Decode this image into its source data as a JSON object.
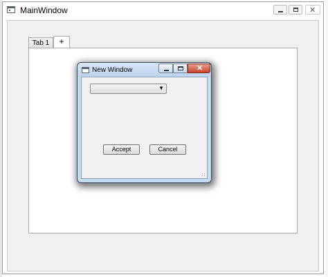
{
  "main_window": {
    "title": "MainWindow",
    "tabs": [
      {
        "label": "Tab 1"
      },
      {
        "label": "+"
      }
    ]
  },
  "dialog": {
    "title": "New Window",
    "combo_value": "",
    "accept_label": "Accept",
    "cancel_label": "Cancel"
  },
  "caption_glyphs": {
    "close": "✕"
  },
  "icons": [
    "app-icon",
    "minimize-icon",
    "maximize-icon",
    "close-icon",
    "dropdown-arrow-icon",
    "resize-grip-icon"
  ],
  "colors": {
    "dialog_frame": "#c6dcf0",
    "close_button": "#c8422b",
    "window_bg": "#f0f0f0"
  }
}
